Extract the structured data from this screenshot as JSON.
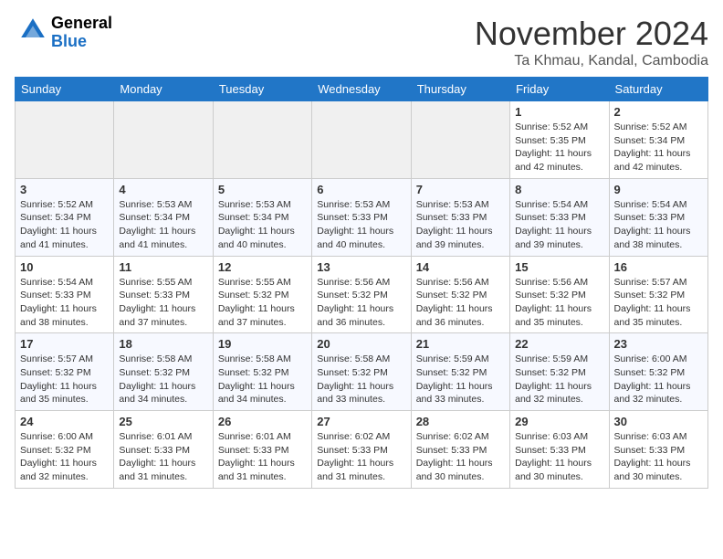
{
  "header": {
    "logo_general": "General",
    "logo_blue": "Blue",
    "month_title": "November 2024",
    "location": "Ta Khmau, Kandal, Cambodia"
  },
  "weekdays": [
    "Sunday",
    "Monday",
    "Tuesday",
    "Wednesday",
    "Thursday",
    "Friday",
    "Saturday"
  ],
  "weeks": [
    [
      {
        "day": "",
        "info": ""
      },
      {
        "day": "",
        "info": ""
      },
      {
        "day": "",
        "info": ""
      },
      {
        "day": "",
        "info": ""
      },
      {
        "day": "",
        "info": ""
      },
      {
        "day": "1",
        "info": "Sunrise: 5:52 AM\nSunset: 5:35 PM\nDaylight: 11 hours and 42 minutes."
      },
      {
        "day": "2",
        "info": "Sunrise: 5:52 AM\nSunset: 5:34 PM\nDaylight: 11 hours and 42 minutes."
      }
    ],
    [
      {
        "day": "3",
        "info": "Sunrise: 5:52 AM\nSunset: 5:34 PM\nDaylight: 11 hours and 41 minutes."
      },
      {
        "day": "4",
        "info": "Sunrise: 5:53 AM\nSunset: 5:34 PM\nDaylight: 11 hours and 41 minutes."
      },
      {
        "day": "5",
        "info": "Sunrise: 5:53 AM\nSunset: 5:34 PM\nDaylight: 11 hours and 40 minutes."
      },
      {
        "day": "6",
        "info": "Sunrise: 5:53 AM\nSunset: 5:33 PM\nDaylight: 11 hours and 40 minutes."
      },
      {
        "day": "7",
        "info": "Sunrise: 5:53 AM\nSunset: 5:33 PM\nDaylight: 11 hours and 39 minutes."
      },
      {
        "day": "8",
        "info": "Sunrise: 5:54 AM\nSunset: 5:33 PM\nDaylight: 11 hours and 39 minutes."
      },
      {
        "day": "9",
        "info": "Sunrise: 5:54 AM\nSunset: 5:33 PM\nDaylight: 11 hours and 38 minutes."
      }
    ],
    [
      {
        "day": "10",
        "info": "Sunrise: 5:54 AM\nSunset: 5:33 PM\nDaylight: 11 hours and 38 minutes."
      },
      {
        "day": "11",
        "info": "Sunrise: 5:55 AM\nSunset: 5:33 PM\nDaylight: 11 hours and 37 minutes."
      },
      {
        "day": "12",
        "info": "Sunrise: 5:55 AM\nSunset: 5:32 PM\nDaylight: 11 hours and 37 minutes."
      },
      {
        "day": "13",
        "info": "Sunrise: 5:56 AM\nSunset: 5:32 PM\nDaylight: 11 hours and 36 minutes."
      },
      {
        "day": "14",
        "info": "Sunrise: 5:56 AM\nSunset: 5:32 PM\nDaylight: 11 hours and 36 minutes."
      },
      {
        "day": "15",
        "info": "Sunrise: 5:56 AM\nSunset: 5:32 PM\nDaylight: 11 hours and 35 minutes."
      },
      {
        "day": "16",
        "info": "Sunrise: 5:57 AM\nSunset: 5:32 PM\nDaylight: 11 hours and 35 minutes."
      }
    ],
    [
      {
        "day": "17",
        "info": "Sunrise: 5:57 AM\nSunset: 5:32 PM\nDaylight: 11 hours and 35 minutes."
      },
      {
        "day": "18",
        "info": "Sunrise: 5:58 AM\nSunset: 5:32 PM\nDaylight: 11 hours and 34 minutes."
      },
      {
        "day": "19",
        "info": "Sunrise: 5:58 AM\nSunset: 5:32 PM\nDaylight: 11 hours and 34 minutes."
      },
      {
        "day": "20",
        "info": "Sunrise: 5:58 AM\nSunset: 5:32 PM\nDaylight: 11 hours and 33 minutes."
      },
      {
        "day": "21",
        "info": "Sunrise: 5:59 AM\nSunset: 5:32 PM\nDaylight: 11 hours and 33 minutes."
      },
      {
        "day": "22",
        "info": "Sunrise: 5:59 AM\nSunset: 5:32 PM\nDaylight: 11 hours and 32 minutes."
      },
      {
        "day": "23",
        "info": "Sunrise: 6:00 AM\nSunset: 5:32 PM\nDaylight: 11 hours and 32 minutes."
      }
    ],
    [
      {
        "day": "24",
        "info": "Sunrise: 6:00 AM\nSunset: 5:32 PM\nDaylight: 11 hours and 32 minutes."
      },
      {
        "day": "25",
        "info": "Sunrise: 6:01 AM\nSunset: 5:33 PM\nDaylight: 11 hours and 31 minutes."
      },
      {
        "day": "26",
        "info": "Sunrise: 6:01 AM\nSunset: 5:33 PM\nDaylight: 11 hours and 31 minutes."
      },
      {
        "day": "27",
        "info": "Sunrise: 6:02 AM\nSunset: 5:33 PM\nDaylight: 11 hours and 31 minutes."
      },
      {
        "day": "28",
        "info": "Sunrise: 6:02 AM\nSunset: 5:33 PM\nDaylight: 11 hours and 30 minutes."
      },
      {
        "day": "29",
        "info": "Sunrise: 6:03 AM\nSunset: 5:33 PM\nDaylight: 11 hours and 30 minutes."
      },
      {
        "day": "30",
        "info": "Sunrise: 6:03 AM\nSunset: 5:33 PM\nDaylight: 11 hours and 30 minutes."
      }
    ]
  ]
}
